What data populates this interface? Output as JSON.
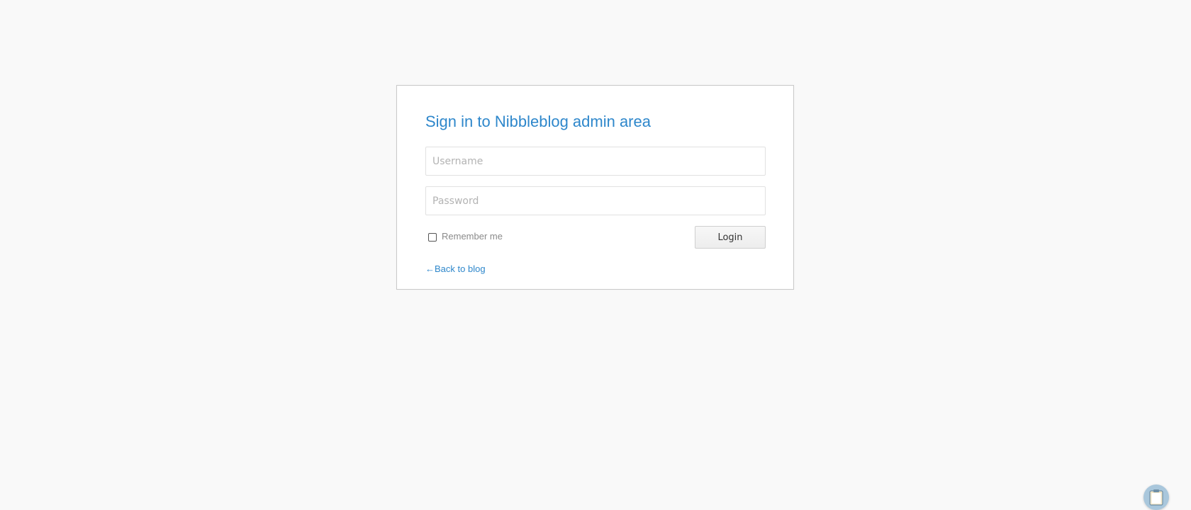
{
  "login": {
    "title": "Sign in to Nibbleblog admin area",
    "username_placeholder": "Username",
    "password_placeholder": "Password",
    "remember_label": "Remember me",
    "login_button": "Login",
    "back_arrow": "←",
    "back_link": "Back to blog"
  },
  "widget": {
    "icon": "clipboard-icon"
  },
  "colors": {
    "accent": "#2e87cb",
    "background": "#f9f9f9"
  }
}
